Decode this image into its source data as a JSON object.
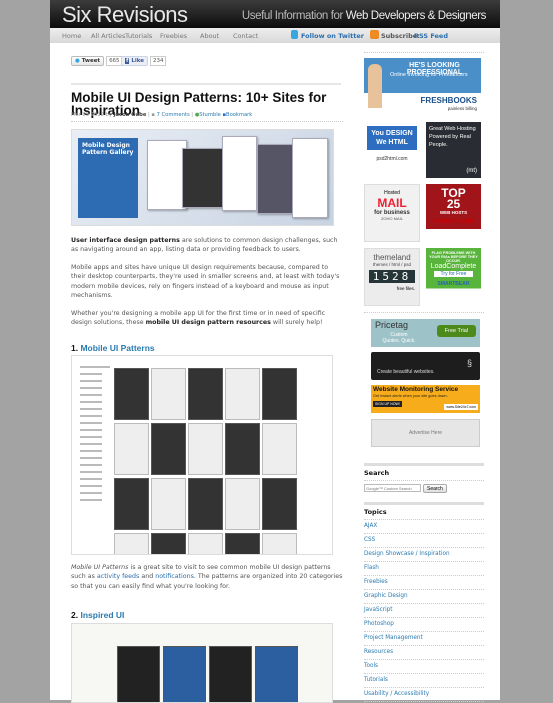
{
  "header": {
    "logo": "Six Revisions",
    "tagline_pre": "Useful Information for ",
    "tagline_bold": "Web Developers & Designers"
  },
  "nav": {
    "items": [
      "Home",
      "All Articles",
      "Tutorials",
      "Freebies",
      "About",
      "Contact"
    ],
    "twitter": "Follow on Twitter",
    "subscribe": "Subscribe:",
    "rss": "RSS Feed"
  },
  "share": {
    "tweet": "Tweet",
    "tweet_count": "665",
    "like": "Like",
    "like_count": "234"
  },
  "article": {
    "title": "Mobile UI Design Patterns: 10+ Sites for Inspiration",
    "date": "Mar 29 2012 by",
    "author": "Jacob Gube",
    "comments": "7 Comments",
    "stumble": "Stumble",
    "bookmark": "Bookmark",
    "hero_text": "Mobile Design Pattern Gallery",
    "p1_bold": "User interface design patterns",
    "p1": " are solutions to common design challenges, such as navigating around an app, listing data or providing feedback to users.",
    "p2": "Mobile apps and sites have unique UI design requirements because, compared to their desktop counterparts, they're used in smaller screens and, at least with today's modern mobile devices, rely on fingers instead of a keyboard and mouse as input mechanisms.",
    "p3a": "Whether you're designing a mobile app UI for the first time or in need of specific design solutions, these ",
    "p3_bold": "mobile UI design pattern resources",
    "p3b": " will surely help!",
    "s1_num": "1.",
    "s1_title": "Mobile UI Patterns",
    "p4_em": "Mobile UI Patterns",
    "p4a": " is a great site to visit to see common mobile UI design patterns such as ",
    "p4_link1": "activity feeds",
    "p4b": " and ",
    "p4_link2": "notifications",
    "p4c": ". The patterns are organized into 20 categories so that you can easily find what you're looking for.",
    "s2_num": "2.",
    "s2_title": "Inspired UI"
  },
  "sidebar": {
    "ads": {
      "freshbooks": [
        "HE'S LOOKING PROFESSIONAL",
        "Online Invoicing for Freelancers",
        "FRESHBOOKS",
        "painless billing"
      ],
      "psd2html": [
        "You DESIGN",
        "We HTML",
        "psd2html.com"
      ],
      "mt": [
        "Great Web Hosting Powered by Real People.",
        "(mt)"
      ],
      "zoho": [
        "Hosted",
        "MAIL",
        "for business",
        "ZOHO MAIL"
      ],
      "top25": [
        "TOP",
        "25",
        "WEB HOSTS",
        "TOPHOSTS.COM"
      ],
      "themeland": [
        "themeland",
        "themes / html / psd",
        "1528",
        "free files."
      ],
      "smartbear": [
        "FLAG PROBLEMS WITH YOUR RIAs BEFORE THEY OCCUR.",
        "LoadComplete",
        "Try for Free",
        "SMARTBEAR"
      ],
      "pricetag": [
        "Pricetag",
        "Custom Quotes. Quick.",
        "Free Trial"
      ],
      "squarespace": [
        "Create beautiful websites."
      ],
      "site24x7": [
        "Website Monitoring Service",
        "Get instant alerts when your site goes down.",
        "SIGN UP NOW!",
        "www.Site24x7.com"
      ],
      "advertise": "Advertise Here"
    },
    "search": {
      "heading": "Search",
      "placeholder": "Google™ Custom Search",
      "button": "Search"
    },
    "topics": {
      "heading": "Topics",
      "items": [
        "AJAX",
        "CSS",
        "Design Showcase / Inspiration",
        "Flash",
        "Freebies",
        "Graphic Design",
        "JavaScript",
        "Photoshop",
        "Project Management",
        "Resources",
        "Tools",
        "Tutorials",
        "Usability / Accessibility"
      ]
    }
  }
}
